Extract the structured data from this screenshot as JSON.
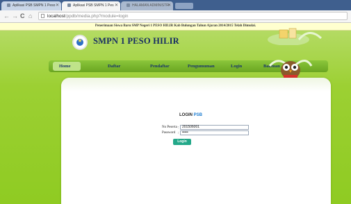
{
  "browser": {
    "tabs": [
      {
        "label": "Aplikasi PSB SMPN 1 Peso",
        "state": "normal"
      },
      {
        "label": "Aplikasi PSB SMPN 1 Pes",
        "state": "active"
      },
      {
        "label": "HALAMAN ADMINISTR",
        "state": "dim"
      }
    ],
    "url": {
      "host": "localhost",
      "path": "/ppdb/media.php?module=login"
    }
  },
  "announcement": "Penerimaan Siswa Baru SMP Negeri 1 PESO HILIR Kab Bulungan Tahun Ajaran 2014/2015 Telah Dimulai.",
  "site": {
    "title": "SMPN 1 PESO HILIR"
  },
  "menu": [
    {
      "label": "Home",
      "active": true
    },
    {
      "label": "Daftar",
      "active": false
    },
    {
      "label": "Pendaftar",
      "active": false
    },
    {
      "label": "Pengumuman",
      "active": false
    },
    {
      "label": "Login",
      "active": false
    },
    {
      "label": "Bantuan",
      "active": false
    }
  ],
  "login": {
    "heading": "LOGIN",
    "heading_suffix": "PSB",
    "fields": [
      {
        "label": "No Peserta",
        "value": "201506001"
      },
      {
        "label": "Password",
        "value": "•••••"
      }
    ],
    "button": "Login"
  },
  "colors": {
    "accent": "#8fcb22",
    "menu_text": "#18356b",
    "button": "#23a889"
  }
}
